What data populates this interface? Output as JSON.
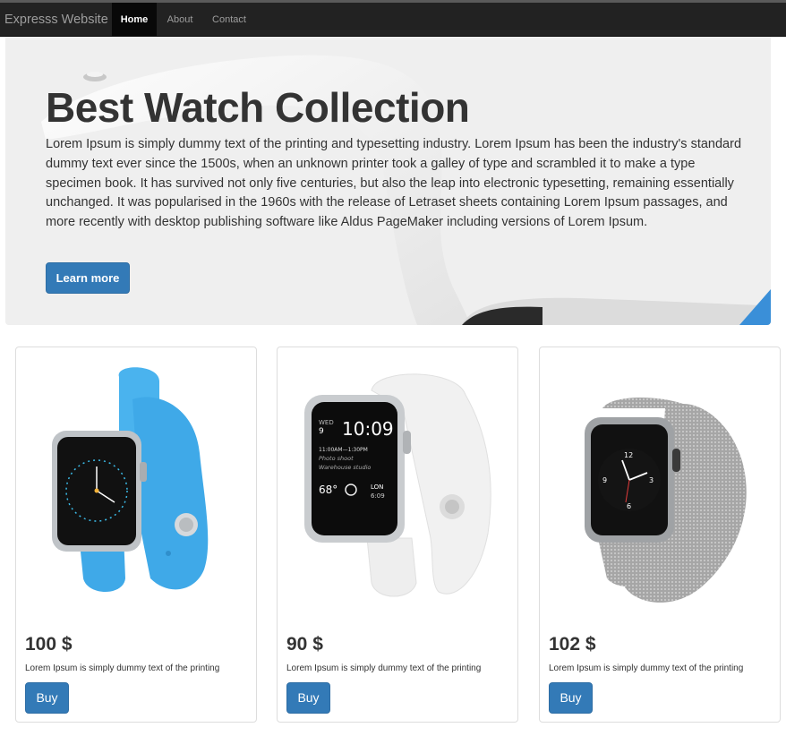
{
  "navbar": {
    "brand": "Expresss Website",
    "items": [
      {
        "label": "Home",
        "active": true
      },
      {
        "label": "About",
        "active": false
      },
      {
        "label": "Contact",
        "active": false
      }
    ]
  },
  "hero": {
    "title": "Best Watch Collection",
    "text": "Lorem Ipsum is simply dummy text of the printing and typesetting industry. Lorem Ipsum has been the industry's standard dummy text ever since the 1500s, when an unknown printer took a galley of type and scrambled it to make a type specimen book. It has survived not only five centuries, but also the leap into electronic typesetting, remaining essentially unchanged. It was popularised in the 1960s with the release of Letraset sheets containing Lorem Ipsum passages, and more recently with desktop publishing software like Aldus PageMaker including versions of Lorem Ipsum.",
    "button_label": "Learn more",
    "background_image": "white-watch-band-photo"
  },
  "products": [
    {
      "price": "100 $",
      "description": "Lorem Ipsum is simply dummy text of the printing",
      "button_label": "Buy",
      "image": "blue-sport-band-watch",
      "band_color": "#4ab3ee"
    },
    {
      "price": "90 $",
      "description": "Lorem Ipsum is simply dummy text of the printing",
      "button_label": "Buy",
      "image": "white-sport-band-watch",
      "band_color": "#eeeeee",
      "face_text": {
        "day": "WED",
        "date": "9",
        "time": "10:09",
        "event_time": "11:00AM—1:30PM",
        "event_line1": "Photo shoot",
        "event_line2": "Warehouse studio",
        "temp": "68°",
        "city": "LON",
        "city_time": "6:09"
      }
    },
    {
      "price": "102 $",
      "description": "Lorem Ipsum is simply dummy text of the printing",
      "button_label": "Buy",
      "image": "milanese-loop-watch",
      "band_color": "#9a9a9a"
    }
  ],
  "colors": {
    "navbar_bg": "#222222",
    "primary": "#337ab7",
    "jumbotron_bg": "#eeeeee"
  }
}
